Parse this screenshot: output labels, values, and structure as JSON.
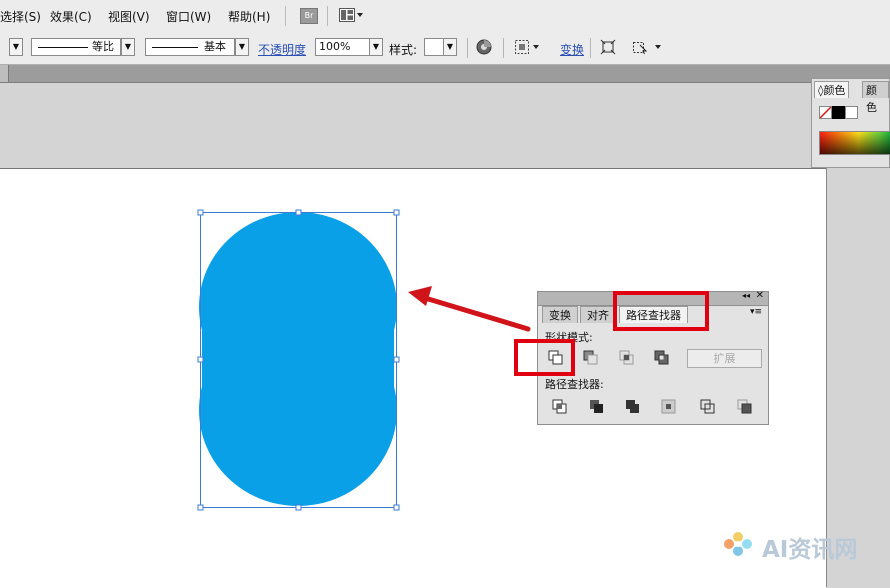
{
  "menubar": {
    "items": [
      "选择(S)",
      "效果(C)",
      "视图(V)",
      "窗口(W)",
      "帮助(H)"
    ],
    "bridge_label": "Br"
  },
  "controlbar": {
    "stroke_profile_label": "等比",
    "brush_label": "基本",
    "opacity_label": "不透明度",
    "opacity_value": "100%",
    "style_label": "样式:",
    "transform_label": "变换"
  },
  "color_panel": {
    "tabs": [
      "颜色",
      "颜色"
    ]
  },
  "pathfinder_panel": {
    "tabs": [
      "变换",
      "对齐",
      "路径查找器"
    ],
    "shape_modes_label": "形状模式:",
    "expand_label": "扩展",
    "pathfinders_label": "路径查找器:"
  },
  "watermark": {
    "text": "AI资讯网"
  },
  "colors": {
    "shape_fill": "#0aa0e8",
    "highlight": "#e0000f",
    "selection": "#3a7bd5"
  }
}
